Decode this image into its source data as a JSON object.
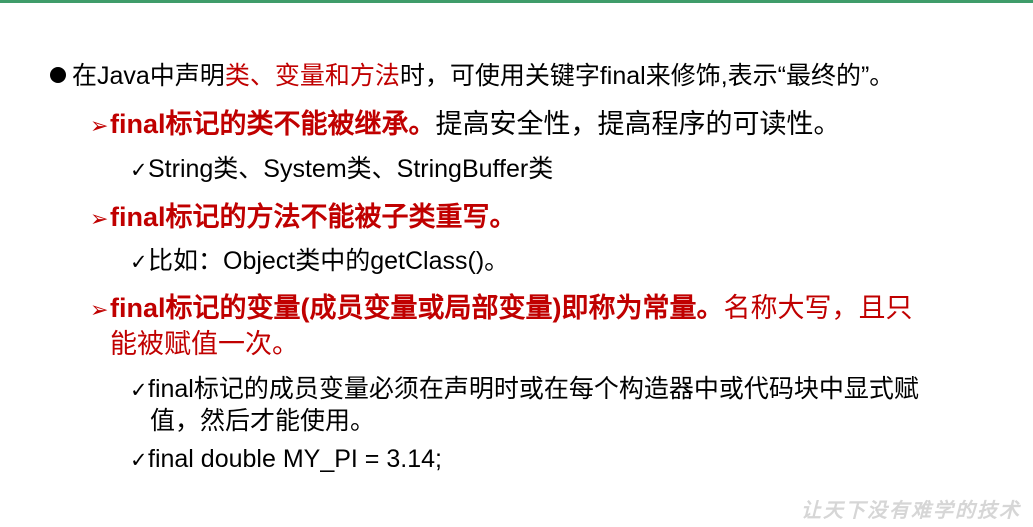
{
  "colors": {
    "accent_red": "#c00000",
    "top_rule": "#3f9c6a",
    "watermark": "#d6d6d6"
  },
  "point1": {
    "bullet_icon": "filled-circle",
    "text_a": "在Java中声明",
    "text_red": "类、变量和方法",
    "text_b": "时，可使用关键字final来修饰,表示“最终的”。"
  },
  "point2": {
    "bullet_icon": "arrow-right",
    "text_bold": "final标记的类不能被继承。",
    "text_normal": "提高安全性，提高程序的可读性。",
    "sub": {
      "bullet_icon": "check",
      "text": "String类、System类、StringBuffer类"
    }
  },
  "point3": {
    "bullet_icon": "arrow-right",
    "text_bold": "final标记的方法不能被子类重写。",
    "sub": {
      "bullet_icon": "check",
      "text": "比如：Object类中的getClass()。"
    }
  },
  "point4": {
    "bullet_icon": "arrow-right",
    "text_bold": "final标记的变量(成员变量或局部变量)即称为常量。",
    "text_normal_line1": "名称大写，且只",
    "text_normal_line2": "能被赋值一次。",
    "sub1": {
      "bullet_icon": "check",
      "line1": "final标记的成员变量必须在声明时或在每个构造器中或代码块中显式赋",
      "line2": "值，然后才能使用。"
    },
    "sub2": {
      "bullet_icon": "check",
      "text": "final double MY_PI = 3.14;"
    }
  },
  "watermark": "让天下没有难学的技术"
}
